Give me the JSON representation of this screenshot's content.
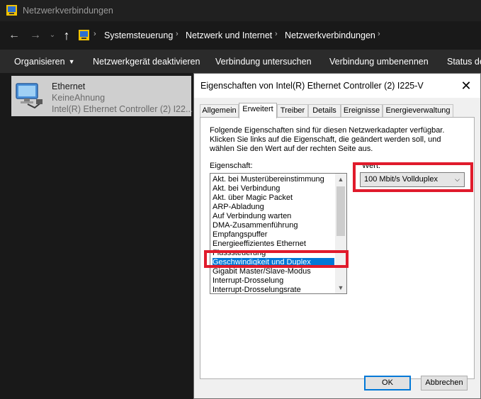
{
  "window": {
    "title": "Netzwerkverbindungen",
    "breadcrumb": [
      "Systemsteuerung",
      "Netzwerk und Internet",
      "Netzwerkverbindungen"
    ]
  },
  "commandbar": {
    "organize": "Organisieren",
    "disable": "Netzwerkgerät deaktivieren",
    "diagnose": "Verbindung untersuchen",
    "rename": "Verbindung umbenennen",
    "status": "Status de"
  },
  "connection": {
    "name": "Ethernet",
    "network": "KeineAhnung",
    "device": "Intel(R) Ethernet Controller (2) I22..."
  },
  "dialog": {
    "title": "Eigenschaften von Intel(R) Ethernet Controller (2) I225-V",
    "tabs": [
      "Allgemein",
      "Erweitert",
      "Treiber",
      "Details",
      "Ereignisse",
      "Energieverwaltung"
    ],
    "active_tab": "Erweitert",
    "description_lines": [
      "Folgende Eigenschaften sind für diesen Netzwerkadapter verfügbar.",
      "Klicken Sie links auf die Eigenschaft, die geändert werden soll, und",
      "wählen Sie den Wert auf der rechten Seite aus."
    ],
    "property_label": "Eigenschaft:",
    "value_label": "Wert:",
    "properties": [
      "Akt. bei Musterübereinstimmung",
      "Akt. bei Verbindung",
      "Akt. über Magic Packet",
      "ARP-Abladung",
      "Auf Verbindung warten",
      "DMA-Zusammenführung",
      "Empfangspuffer",
      "Energieeffizientes Ethernet",
      "Flusssteuerung",
      "Geschwindigkeit und Duplex",
      "Gigabit Master/Slave-Modus",
      "Interrupt-Drosselung",
      "Interrupt-Drosselungsrate"
    ],
    "selected_property": "Geschwindigkeit und Duplex",
    "value": "100 Mbit/s Vollduplex",
    "ok": "OK",
    "cancel": "Abbrechen"
  },
  "colors": {
    "highlight": "#e01b2c",
    "selection": "#0078d7",
    "explorer_bg": "#191919"
  }
}
